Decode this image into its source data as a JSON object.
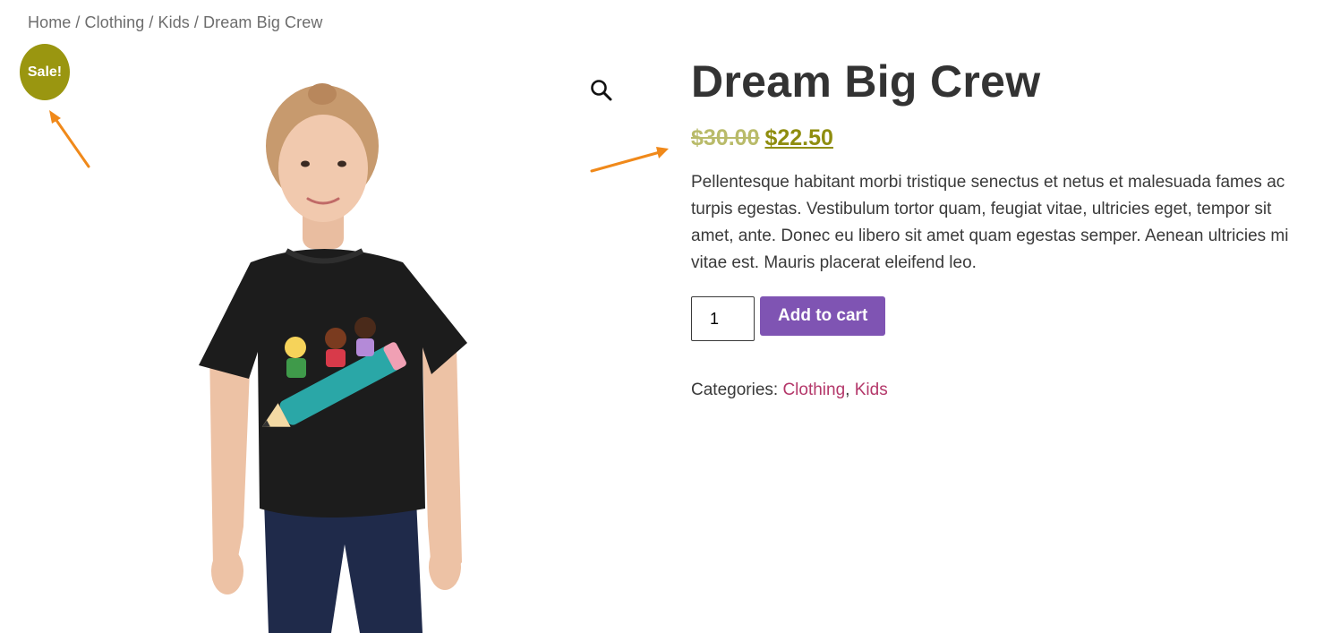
{
  "breadcrumb": {
    "items": [
      "Home",
      "Clothing",
      "Kids",
      "Dream Big Crew"
    ],
    "separator": "/"
  },
  "badge": {
    "label": "Sale!",
    "color": "#9a9610"
  },
  "icons": {
    "zoom": "magnifier-icon"
  },
  "product": {
    "title": "Dream Big Crew",
    "old_price": "$30.00",
    "new_price": "$22.50",
    "description": "Pellentesque habitant morbi tristique senectus et netus et malesuada fames ac turpis egestas. Vestibulum tortor quam, feugiat vitae, ultricies eget, tempor sit amet, ante. Donec eu libero sit amet quam egestas semper. Aenean ultricies mi vitae est. Mauris placerat eleifend leo.",
    "quantity": "1",
    "add_to_cart_label": "Add to cart",
    "categories_label": "Categories:",
    "categories": [
      "Clothing",
      "Kids"
    ],
    "category_separator": ","
  },
  "colors": {
    "accent_button": "#7f54b3",
    "sale_price": "#8f8d0f",
    "category_link": "#b4386a",
    "annotation_arrow": "#f0891a"
  }
}
